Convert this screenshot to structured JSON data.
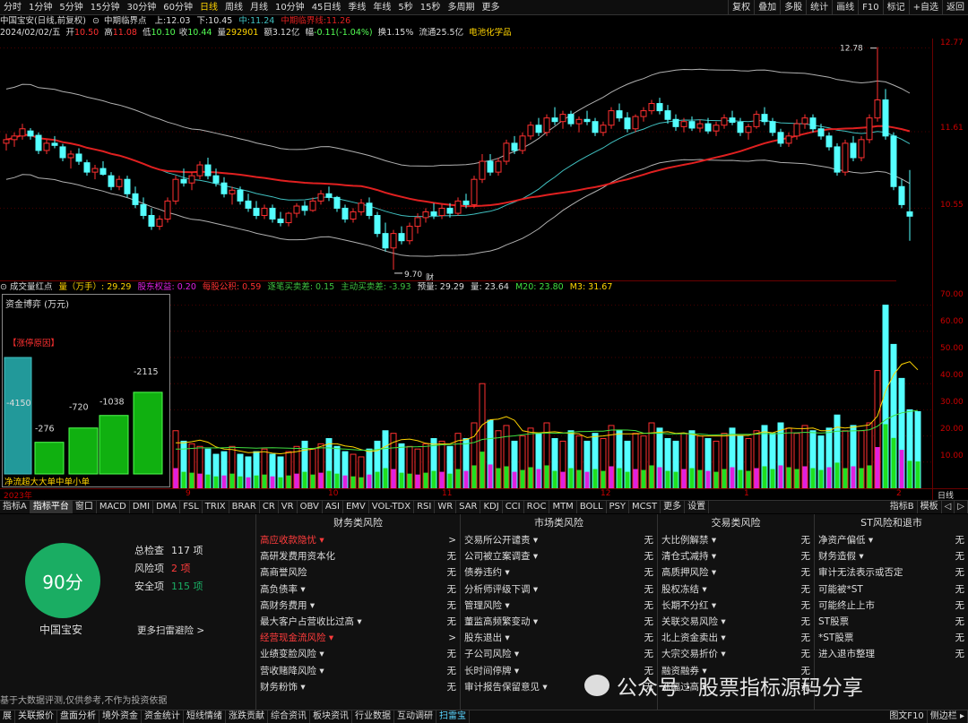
{
  "period_tabs": [
    "分时",
    "1分钟",
    "5分钟",
    "15分钟",
    "30分钟",
    "60分钟",
    "日线",
    "周线",
    "月线",
    "10分钟",
    "45日线",
    "季线",
    "年线",
    "5秒",
    "15秒",
    "多周期",
    "更多"
  ],
  "active_period": "日线",
  "right_tabs": [
    "复权",
    "叠加",
    "多股",
    "统计",
    "画线",
    "F10",
    "标记",
    "+自选",
    "返回"
  ],
  "chart_title": "中国宝安(日线,前复权)",
  "indicator_name": "中期临界点",
  "ind_up_label": "上:",
  "ind_up": "12.03",
  "ind_down_label": "下:",
  "ind_down": "10.45",
  "ind_mid_label": "中:",
  "ind_mid": "11.24",
  "ind_crit_label": "中期临界线:",
  "ind_crit": "11.26",
  "date": "2024/02/02/五",
  "open_label": "开",
  "open": "10.50",
  "high_label": "高",
  "high": "11.08",
  "low_label": "低",
  "low": "10.10",
  "close_label": "收",
  "close": "10.44",
  "vol_label": "量",
  "vol": "292901",
  "amount_label": "额",
  "amount": "3.12亿",
  "change_label": "幅",
  "change": "-0.11(-1.04%)",
  "turnover_label": "换",
  "turnover": "1.15%",
  "float_label": "流通",
  "float": "25.5亿",
  "sector": "电池化学品",
  "price_ticks": [
    "12.77",
    "11.61",
    "10.55"
  ],
  "vol_ticks": [
    "70.00",
    "60.00",
    "50.00",
    "40.00",
    "30.00",
    "20.00",
    "10.00"
  ],
  "hi_mark": "12.78",
  "lo_mark": "9.70",
  "cai_mark": "财",
  "vol_header": {
    "name": "成交量红点",
    "vol": "量（万手）: 29.29",
    "holder": "股东权益: 0.20",
    "reserve": "每股公积: 0.59",
    "trades": "逐笔买卖差: 0.15",
    "active": "主动买卖差: -3.93",
    "pred": "预量: 29.29",
    "ma5": "量: 23.64",
    "ma20": "M20: 23.80",
    "m3": "M3: 31.67"
  },
  "fund_panel": {
    "title": "资金博弈 (万元)",
    "reason": "【涨停原因】",
    "values": [
      "-4150",
      "-276",
      "-720",
      "-1038",
      "-2115"
    ],
    "labels": [
      "净流",
      "超大",
      "大单",
      "中单",
      "小单"
    ]
  },
  "x_labels": [
    "2023年",
    "9",
    "10",
    "11",
    "12",
    "1",
    "2"
  ],
  "x_right": "日线",
  "indicator_tabs": [
    "指标A",
    "指标平台",
    "窗口",
    "MACD",
    "DMI",
    "DMA",
    "FSL",
    "TRIX",
    "BRAR",
    "CR",
    "VR",
    "OBV",
    "ASI",
    "EMV",
    "VOL-TDX",
    "RSI",
    "WR",
    "SAR",
    "KDJ",
    "CCI",
    "ROC",
    "MTM",
    "BOLL",
    "PSY",
    "MCST",
    "更多",
    "设置"
  ],
  "active_indicator_tab": "指标平台",
  "right_indicator_tabs": [
    "指标B",
    "模板",
    "◁",
    "▷"
  ],
  "risk": {
    "score": "90分",
    "name": "中国宝安",
    "total_label": "总检查",
    "total": "117 项",
    "risk_label": "风险项",
    "risk_count": "2 项",
    "safe_label": "安全项",
    "safe": "115 项",
    "more": "更多扫雷避险 >"
  },
  "columns": [
    {
      "title": "财务类风险",
      "rows": [
        [
          "高应收款隐忧 ▾",
          ">",
          1
        ],
        [
          "高研发费用资本化",
          "无",
          0
        ],
        [
          "高商誉风险",
          "无",
          0
        ],
        [
          "高负债率 ▾",
          "无",
          0
        ],
        [
          "高财务费用 ▾",
          "无",
          0
        ],
        [
          "最大客户占营收比过高 ▾",
          "无",
          0
        ],
        [
          "经营现金流风险 ▾",
          ">",
          1
        ],
        [
          "业绩变脸风险 ▾",
          "无",
          0
        ],
        [
          "营收赌降风险 ▾",
          "无",
          0
        ],
        [
          "财务粉饰 ▾",
          "无",
          0
        ]
      ]
    },
    {
      "title": "市场类风险",
      "rows": [
        [
          "交易所公开谴责 ▾",
          "无",
          0
        ],
        [
          "公司被立案调查 ▾",
          "无",
          0
        ],
        [
          "债券违约 ▾",
          "无",
          0
        ],
        [
          "分析师评级下调 ▾",
          "无",
          0
        ],
        [
          "管理风险 ▾",
          "无",
          0
        ],
        [
          "董监高频繁变动 ▾",
          "无",
          0
        ],
        [
          "股东退出 ▾",
          "无",
          0
        ],
        [
          "子公司风险 ▾",
          "无",
          0
        ],
        [
          "长时间停牌 ▾",
          "无",
          0
        ],
        [
          "审计报告保留意见 ▾",
          "无",
          0
        ]
      ]
    },
    {
      "title": "交易类风险",
      "rows": [
        [
          "大比例解禁 ▾",
          "无",
          0
        ],
        [
          "清仓式减持 ▾",
          "无",
          0
        ],
        [
          "高质押风险 ▾",
          "无",
          0
        ],
        [
          "股权冻结 ▾",
          "无",
          0
        ],
        [
          "长期不分红 ▾",
          "无",
          0
        ],
        [
          "关联交易风险 ▾",
          "无",
          0
        ],
        [
          "北上资金卖出 ▾",
          "无",
          0
        ],
        [
          "大宗交易折价 ▾",
          "无",
          0
        ],
        [
          "融资融券 ▾",
          "无",
          0
        ],
        [
          "涨幅过高 ▾",
          "无",
          0
        ]
      ]
    },
    {
      "title": "ST风险和退市",
      "rows": [
        [
          "净资产偏低 ▾",
          "无",
          0
        ],
        [
          "财务造假 ▾",
          "无",
          0
        ],
        [
          "审计无法表示或否定",
          "无",
          0
        ],
        [
          "可能被*ST",
          "无",
          0
        ],
        [
          "可能终止上市",
          "无",
          0
        ],
        [
          "ST股票",
          "无",
          0
        ],
        [
          "*ST股票",
          "无",
          0
        ],
        [
          "进入退市整理",
          "无",
          0
        ]
      ]
    }
  ],
  "disclaimer": "基于大数据评测,仅供参考,不作为投资依据",
  "status_tabs": [
    "展",
    "关联报价",
    "盘面分析",
    "境外资金",
    "资金统计",
    "短线情绪",
    "涨跌贡献",
    "综合资讯",
    "板块资讯",
    "行业数据",
    "互动调研",
    "扫雷宝"
  ],
  "active_status_tab": "扫雷宝",
  "status_right": [
    "图文F10",
    "侧边栏 ▸"
  ],
  "watermark": "公众号 · 股票指标源码分享",
  "colors": {
    "up": "#ff3030",
    "down": "#54ffff",
    "ma_red": "#e02020",
    "ma_cyan": "#40c0c0",
    "band": "#b0b0b0",
    "vol_green": "#20e020",
    "vol_magenta": "#e020e0"
  },
  "chart_data": [
    {
      "type": "candlestick",
      "title": "中国宝安(日线,前复权)",
      "ylim": [
        9.6,
        12.9
      ],
      "x": [
        "2023-08-30",
        "2024-02-02"
      ],
      "ohlc": [
        [
          11.45,
          11.58,
          11.35,
          11.5
        ],
        [
          11.5,
          11.6,
          11.4,
          11.55
        ],
        [
          11.55,
          11.72,
          11.5,
          11.65
        ],
        [
          11.62,
          11.66,
          11.5,
          11.55
        ],
        [
          11.56,
          11.6,
          11.3,
          11.35
        ],
        [
          11.35,
          11.5,
          11.3,
          11.45
        ],
        [
          11.45,
          11.55,
          11.38,
          11.42
        ],
        [
          11.4,
          11.44,
          11.2,
          11.25
        ],
        [
          11.25,
          11.35,
          11.1,
          11.3
        ],
        [
          11.3,
          11.38,
          11.15,
          11.2
        ],
        [
          11.18,
          11.22,
          11.0,
          11.05
        ],
        [
          11.05,
          11.15,
          10.95,
          11.1
        ],
        [
          11.1,
          11.2,
          11.0,
          11.02
        ],
        [
          11.0,
          11.05,
          10.8,
          10.85
        ],
        [
          10.85,
          11.0,
          10.8,
          10.95
        ],
        [
          10.95,
          11.0,
          10.7,
          10.75
        ],
        [
          10.75,
          10.85,
          10.55,
          10.6
        ],
        [
          10.6,
          10.7,
          10.4,
          10.45
        ],
        [
          10.45,
          10.55,
          10.25,
          10.3
        ],
        [
          10.3,
          10.45,
          10.25,
          10.4
        ],
        [
          10.4,
          10.7,
          10.35,
          10.65
        ],
        [
          10.65,
          11.0,
          10.6,
          10.95
        ],
        [
          10.95,
          11.1,
          10.85,
          10.9
        ],
        [
          10.9,
          11.05,
          10.8,
          11.0
        ],
        [
          11.0,
          11.2,
          10.95,
          11.15
        ],
        [
          11.15,
          11.25,
          10.95,
          11.0
        ],
        [
          11.0,
          11.1,
          10.85,
          10.9
        ],
        [
          10.9,
          10.98,
          10.7,
          10.75
        ],
        [
          10.75,
          10.85,
          10.6,
          10.8
        ],
        [
          10.8,
          10.85,
          10.6,
          10.65
        ],
        [
          10.65,
          10.75,
          10.5,
          10.55
        ],
        [
          10.55,
          10.65,
          10.4,
          10.45
        ],
        [
          10.45,
          10.6,
          10.4,
          10.55
        ],
        [
          10.55,
          10.6,
          10.35,
          10.4
        ],
        [
          10.4,
          10.5,
          10.3,
          10.35
        ],
        [
          10.35,
          10.5,
          10.3,
          10.48
        ],
        [
          10.48,
          10.62,
          10.42,
          10.58
        ],
        [
          10.58,
          10.65,
          10.45,
          10.52
        ],
        [
          10.52,
          10.7,
          10.5,
          10.65
        ],
        [
          10.65,
          10.8,
          10.6,
          10.75
        ],
        [
          10.75,
          10.85,
          10.65,
          10.7
        ],
        [
          10.7,
          10.72,
          10.5,
          10.55
        ],
        [
          10.55,
          10.6,
          10.35,
          10.4
        ],
        [
          10.4,
          10.55,
          10.35,
          10.5
        ],
        [
          10.5,
          10.68,
          10.45,
          10.62
        ],
        [
          10.62,
          10.7,
          10.4,
          10.45
        ],
        [
          10.45,
          10.5,
          10.15,
          10.2
        ],
        [
          10.2,
          10.35,
          9.95,
          10.0
        ],
        [
          10.0,
          10.25,
          9.7,
          10.2
        ],
        [
          10.2,
          10.3,
          10.05,
          10.1
        ],
        [
          10.1,
          10.35,
          10.05,
          10.3
        ],
        [
          10.3,
          10.48,
          10.2,
          10.42
        ],
        [
          10.42,
          10.55,
          10.35,
          10.5
        ],
        [
          10.5,
          10.62,
          10.4,
          10.45
        ],
        [
          10.45,
          10.6,
          10.4,
          10.55
        ],
        [
          10.55,
          10.62,
          10.42,
          10.48
        ],
        [
          10.48,
          10.7,
          10.45,
          10.65
        ],
        [
          10.65,
          10.75,
          10.55,
          10.6
        ],
        [
          10.6,
          11.0,
          10.55,
          10.95
        ],
        [
          10.95,
          11.3,
          10.9,
          11.2
        ],
        [
          11.2,
          11.3,
          11.0,
          11.05
        ],
        [
          11.05,
          11.25,
          11.0,
          11.2
        ],
        [
          11.2,
          11.5,
          11.15,
          11.45
        ],
        [
          11.45,
          11.55,
          11.3,
          11.35
        ],
        [
          11.35,
          11.6,
          11.3,
          11.55
        ],
        [
          11.55,
          11.75,
          11.5,
          11.7
        ],
        [
          11.7,
          11.8,
          11.55,
          11.6
        ],
        [
          11.6,
          11.85,
          11.55,
          11.8
        ],
        [
          11.8,
          11.95,
          11.7,
          11.75
        ],
        [
          11.75,
          11.9,
          11.65,
          11.85
        ],
        [
          11.85,
          11.9,
          11.68,
          11.72
        ],
        [
          11.72,
          11.82,
          11.6,
          11.78
        ],
        [
          11.78,
          11.9,
          11.7,
          11.75
        ],
        [
          11.75,
          11.8,
          11.55,
          11.6
        ],
        [
          11.6,
          11.75,
          11.55,
          11.7
        ],
        [
          11.7,
          11.95,
          11.65,
          11.9
        ],
        [
          11.9,
          12.0,
          11.75,
          11.8
        ],
        [
          11.8,
          11.88,
          11.6,
          11.65
        ],
        [
          11.65,
          11.85,
          11.6,
          11.82
        ],
        [
          11.82,
          11.95,
          11.75,
          11.9
        ],
        [
          11.9,
          12.05,
          11.85,
          12.0
        ],
        [
          12.0,
          12.08,
          11.85,
          11.9
        ],
        [
          11.9,
          11.98,
          11.72,
          11.78
        ],
        [
          11.78,
          11.85,
          11.62,
          11.68
        ],
        [
          11.68,
          11.8,
          11.6,
          11.75
        ],
        [
          11.75,
          11.82,
          11.62,
          11.66
        ],
        [
          11.66,
          11.78,
          11.6,
          11.72
        ],
        [
          11.72,
          11.8,
          11.58,
          11.62
        ],
        [
          11.62,
          11.75,
          11.55,
          11.7
        ],
        [
          11.7,
          11.85,
          11.65,
          11.8
        ],
        [
          11.8,
          11.9,
          11.7,
          11.74
        ],
        [
          11.74,
          11.8,
          11.55,
          11.6
        ],
        [
          11.6,
          11.72,
          11.5,
          11.68
        ],
        [
          11.68,
          11.9,
          11.65,
          11.85
        ],
        [
          11.85,
          11.95,
          11.7,
          11.75
        ],
        [
          11.75,
          11.8,
          11.55,
          11.6
        ],
        [
          11.6,
          11.65,
          11.4,
          11.45
        ],
        [
          11.45,
          11.6,
          11.4,
          11.55
        ],
        [
          11.55,
          11.78,
          11.5,
          11.72
        ],
        [
          11.72,
          11.85,
          11.65,
          11.8
        ],
        [
          11.8,
          11.85,
          11.6,
          11.65
        ],
        [
          11.65,
          11.72,
          11.5,
          11.55
        ],
        [
          11.55,
          11.6,
          11.35,
          11.4
        ],
        [
          11.4,
          11.45,
          11.0,
          11.05
        ],
        [
          11.05,
          11.5,
          11.0,
          11.45
        ],
        [
          11.45,
          11.55,
          11.2,
          11.25
        ],
        [
          11.25,
          11.55,
          11.2,
          11.5
        ],
        [
          11.5,
          11.85,
          11.45,
          11.8
        ],
        [
          11.8,
          12.78,
          11.75,
          12.05
        ],
        [
          12.05,
          12.2,
          11.5,
          11.55
        ],
        [
          11.55,
          11.6,
          10.8,
          10.85
        ],
        [
          10.85,
          10.95,
          10.55,
          10.6
        ],
        [
          10.5,
          11.08,
          10.1,
          10.44
        ]
      ]
    },
    {
      "type": "bar",
      "title": "成交量红点",
      "ylabel": "量（万手）",
      "ylim": [
        0,
        75
      ],
      "values": [
        17,
        14,
        16,
        13,
        12,
        15,
        14,
        12,
        13,
        15,
        14,
        16,
        13,
        12,
        14,
        16,
        17,
        18,
        15,
        13,
        19,
        22,
        18,
        17,
        16,
        15,
        13,
        14,
        16,
        13,
        12,
        14,
        15,
        13,
        12,
        14,
        16,
        18,
        15,
        17,
        19,
        16,
        14,
        13,
        12,
        15,
        18,
        22,
        21,
        17,
        16,
        15,
        17,
        19,
        18,
        16,
        21,
        19,
        25,
        40,
        26,
        22,
        24,
        18,
        20,
        23,
        21,
        25,
        19,
        18,
        22,
        20,
        18,
        21,
        19,
        24,
        22,
        18,
        21,
        20,
        25,
        23,
        19,
        18,
        21,
        22,
        20,
        19,
        18,
        21,
        23,
        20,
        19,
        22,
        24,
        21,
        25,
        23,
        21,
        24,
        22,
        20,
        23,
        28,
        22,
        24,
        22,
        25,
        45,
        70,
        55,
        42,
        30,
        29.29
      ]
    },
    {
      "type": "bar",
      "title": "资金博弈 (万元)",
      "categories": [
        "净流",
        "超大",
        "大单",
        "中单",
        "小单"
      ],
      "values": [
        -4150,
        -276,
        -720,
        -1038,
        -2115
      ]
    }
  ]
}
